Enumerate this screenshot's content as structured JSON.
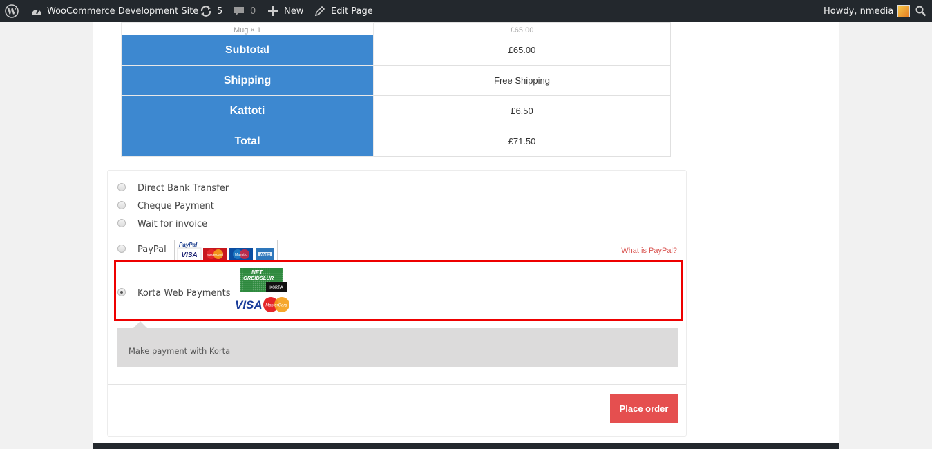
{
  "adminbar": {
    "site_name": "WooCommerce Development Site",
    "updates_count": "5",
    "comments_count": "0",
    "new_label": "New",
    "edit_label": "Edit Page",
    "howdy": "Howdy, nmedia"
  },
  "totals": {
    "partial_row": {
      "label": "Mug × 1",
      "value": "£65.00"
    },
    "rows": [
      {
        "label": "Subtotal",
        "value": "£65.00"
      },
      {
        "label": "Shipping",
        "value": "Free Shipping"
      },
      {
        "label": "Kattoti",
        "value": "£6.50"
      },
      {
        "label": "Total",
        "value": "£71.50"
      }
    ]
  },
  "payment": {
    "methods": [
      {
        "label": "Direct Bank Transfer",
        "selected": false
      },
      {
        "label": "Cheque Payment",
        "selected": false
      },
      {
        "label": "Wait for invoice",
        "selected": false
      },
      {
        "label": "PayPal",
        "selected": false
      },
      {
        "label": "Korta Web Payments",
        "selected": true
      }
    ],
    "paypal_logo": {
      "brand": "PayPal",
      "cards": [
        "VISA",
        "MasterCard",
        "Maestro",
        "AMEX"
      ]
    },
    "paypal_link": "What is PayPal?",
    "korta_logo": {
      "line1": "NET",
      "line2": "GREIÐSLUR",
      "line3": "KORTA"
    },
    "korta_cards": [
      "VISA",
      "MasterCard"
    ],
    "description": "Make payment with Korta",
    "place_order": "Place order"
  },
  "colors": {
    "adminbar": "#23282d",
    "table_header": "#3d88d0",
    "highlight": "#ee0000",
    "button": "#e54f4f"
  }
}
